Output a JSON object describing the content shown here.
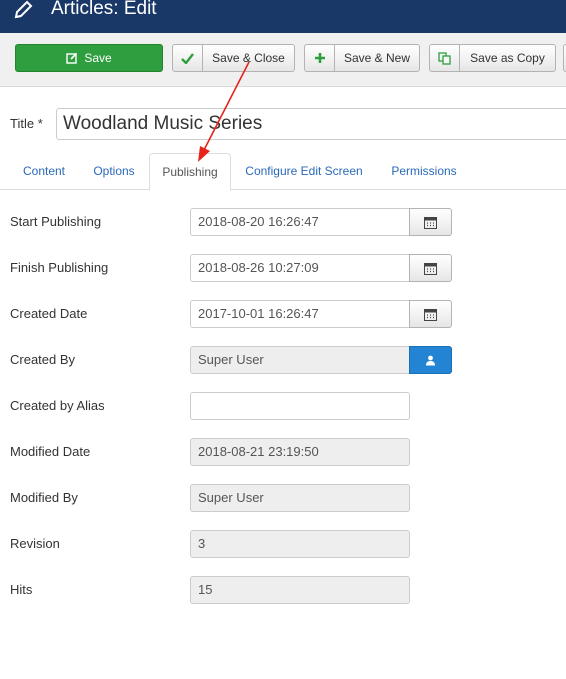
{
  "header": {
    "title": "Articles: Edit"
  },
  "toolbar": {
    "save": "Save",
    "save_close": "Save & Close",
    "save_new": "Save & New",
    "save_copy": "Save as Copy"
  },
  "title_field": {
    "label": "Title *",
    "value": "Woodland Music Series"
  },
  "tabs": [
    {
      "label": "Content"
    },
    {
      "label": "Options"
    },
    {
      "label": "Publishing",
      "active": true
    },
    {
      "label": "Configure Edit Screen"
    },
    {
      "label": "Permissions"
    }
  ],
  "publishing": {
    "start_publishing": {
      "label": "Start Publishing",
      "value": "2018-08-20 16:26:47"
    },
    "finish_publishing": {
      "label": "Finish Publishing",
      "value": "2018-08-26 10:27:09"
    },
    "created_date": {
      "label": "Created Date",
      "value": "2017-10-01 16:26:47"
    },
    "created_by": {
      "label": "Created By",
      "value": "Super User"
    },
    "created_by_alias": {
      "label": "Created by Alias",
      "value": ""
    },
    "modified_date": {
      "label": "Modified Date",
      "value": "2018-08-21 23:19:50"
    },
    "modified_by": {
      "label": "Modified By",
      "value": "Super User"
    },
    "revision": {
      "label": "Revision",
      "value": "3"
    },
    "hits": {
      "label": "Hits",
      "value": "15"
    }
  },
  "icons": {
    "header": "pencil-icon",
    "save": "edit-icon",
    "save_close": "check-icon",
    "save_new": "plus-icon",
    "save_copy": "copy-icon",
    "calendar": "calendar-icon",
    "user": "user-icon"
  },
  "colors": {
    "header_bg": "#1a3867",
    "save_green": "#2f9e3f",
    "user_blue": "#2384d3",
    "annotation_red": "#e8231b"
  }
}
